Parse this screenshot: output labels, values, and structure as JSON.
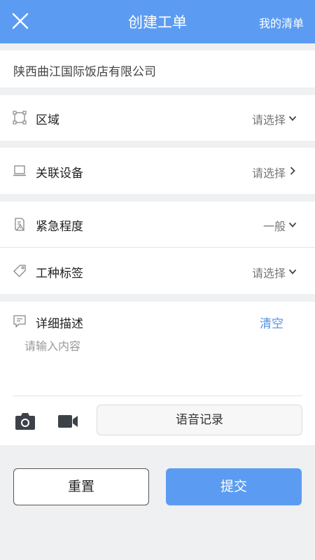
{
  "header": {
    "title": "创建工单",
    "right_link": "我的清单"
  },
  "company": {
    "name": "陕西曲江国际饭店有限公司"
  },
  "fields": [
    {
      "label": "区域",
      "value": "请选择",
      "icon": "area-frame-icon",
      "arrow": "chevron-down-icon"
    },
    {
      "label": "关联设备",
      "value": "请选择",
      "icon": "laptop-icon",
      "arrow": "chevron-right-icon"
    },
    {
      "label": "紧急程度",
      "value": "一般",
      "icon": "document-warning-icon",
      "arrow": "chevron-down-icon"
    },
    {
      "label": "工种标签",
      "value": "请选择",
      "icon": "tag-icon",
      "arrow": "chevron-down-icon"
    }
  ],
  "description": {
    "label": "详细描述",
    "clear": "清空",
    "placeholder": "请输入内容",
    "icon": "comment-icon"
  },
  "media": {
    "camera_icon": "camera-icon",
    "video_icon": "video-camera-icon",
    "voice_label": "语音记录"
  },
  "buttons": {
    "reset": "重置",
    "submit": "提交"
  },
  "colors": {
    "primary": "#5b9cf2",
    "link": "#4f91e8",
    "background": "#eff0f2"
  }
}
